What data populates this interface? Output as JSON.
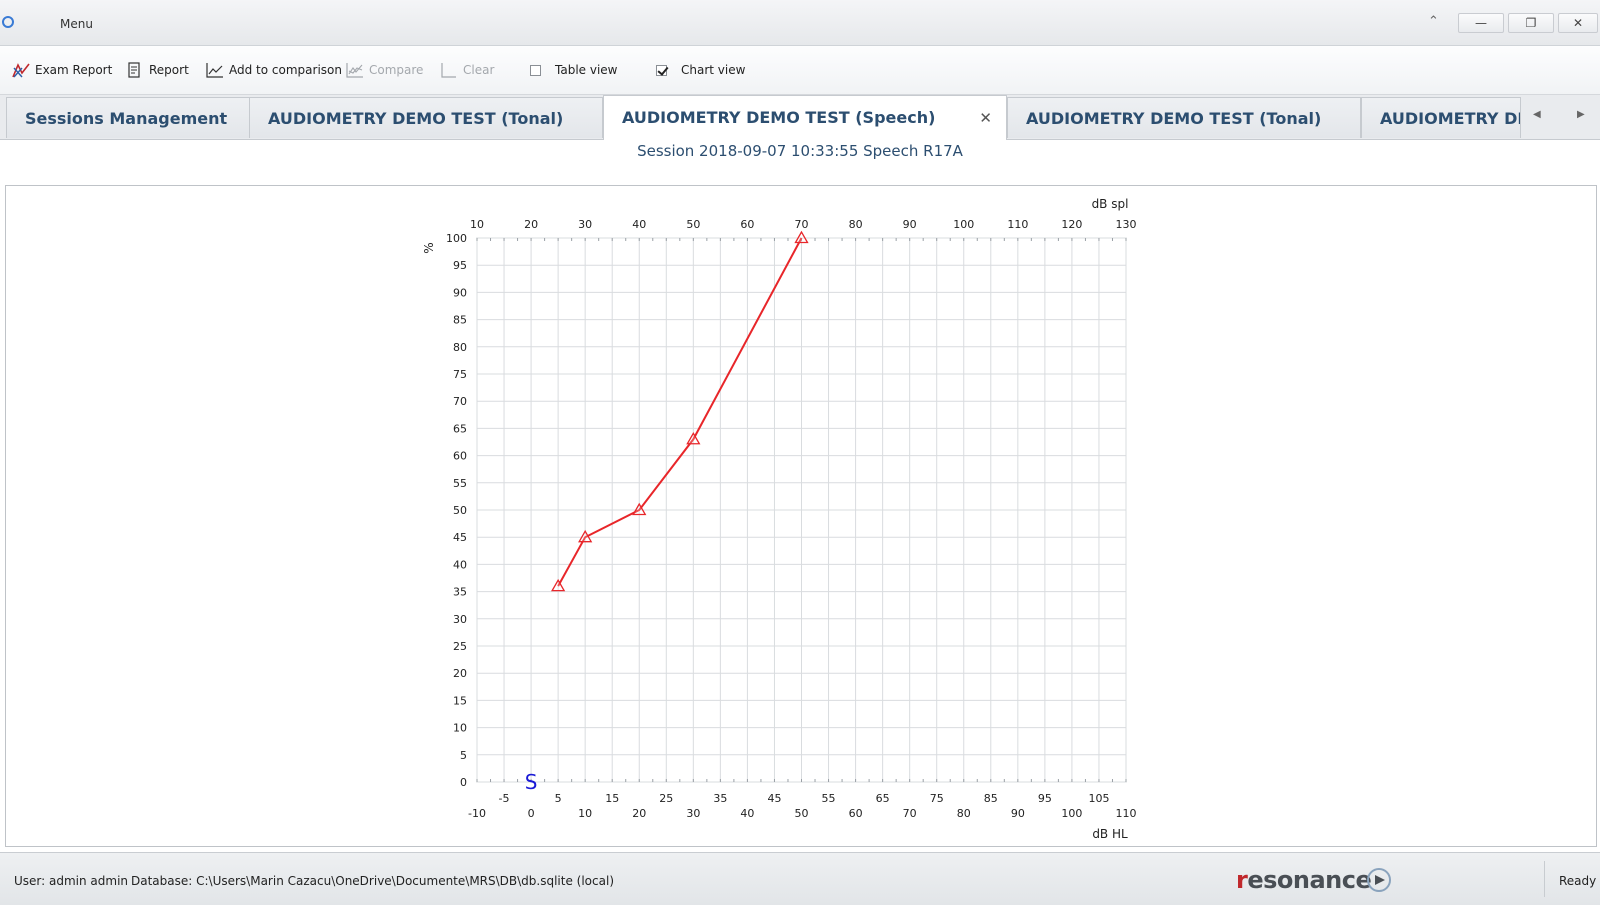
{
  "titlebar": {
    "menu_label": "Menu",
    "minimize_label": "—",
    "restore_label": "❐",
    "close_label": "✕"
  },
  "toolbar": {
    "exam_report": "Exam Report",
    "report": "Report",
    "add_to_comparison": "Add to comparison",
    "compare": "Compare",
    "clear": "Clear",
    "table_view": "Table view",
    "table_view_checked": false,
    "chart_view": "Chart view",
    "chart_view_checked": true
  },
  "tabs": [
    {
      "label": "Sessions Management",
      "active": false
    },
    {
      "label": "AUDIOMETRY DEMO TEST (Tonal)",
      "active": false
    },
    {
      "label": "AUDIOMETRY DEMO TEST (Speech)",
      "active": true
    },
    {
      "label": "AUDIOMETRY DEMO TEST (Tonal)",
      "active": false
    },
    {
      "label": "AUDIOMETRY DE",
      "active": false
    }
  ],
  "session_title": "Session 2018-09-07 10:33:55  Speech R17A",
  "chart_data": {
    "type": "line",
    "title": "",
    "xlabel": "dB HL",
    "x2label": "dB spl",
    "ylabel": "%",
    "xlim": [
      -10,
      110
    ],
    "ylim": [
      0,
      100
    ],
    "x_ticks_bottom": [
      -10,
      0,
      10,
      20,
      30,
      40,
      50,
      60,
      70,
      80,
      90,
      100,
      110
    ],
    "x_ticks_bottom_minor": [
      -5,
      5,
      15,
      25,
      35,
      45,
      55,
      65,
      75,
      85,
      95,
      105
    ],
    "x_ticks_top": [
      10,
      20,
      30,
      40,
      50,
      60,
      70,
      80,
      90,
      100,
      110,
      120,
      130
    ],
    "y_ticks": [
      0,
      5,
      10,
      15,
      20,
      25,
      30,
      35,
      40,
      45,
      50,
      55,
      60,
      65,
      70,
      75,
      80,
      85,
      90,
      95,
      100
    ],
    "grid": true,
    "series": [
      {
        "color": "#e8262a",
        "marker": "triangle",
        "x": [
          5,
          10,
          20,
          30,
          50
        ],
        "y": [
          36,
          45,
          50,
          63,
          100
        ]
      }
    ],
    "annotation": {
      "text": "S",
      "x": 0,
      "y": 0,
      "color": "#1a1ad6"
    }
  },
  "statusbar": {
    "user": "User: admin admin",
    "database": "Database: C:\\Users\\Marin Cazacu\\OneDrive\\Documente\\MRS\\DB\\db.sqlite (local)",
    "status": "Ready",
    "logo_r": "r",
    "logo_rest": "esonance"
  }
}
